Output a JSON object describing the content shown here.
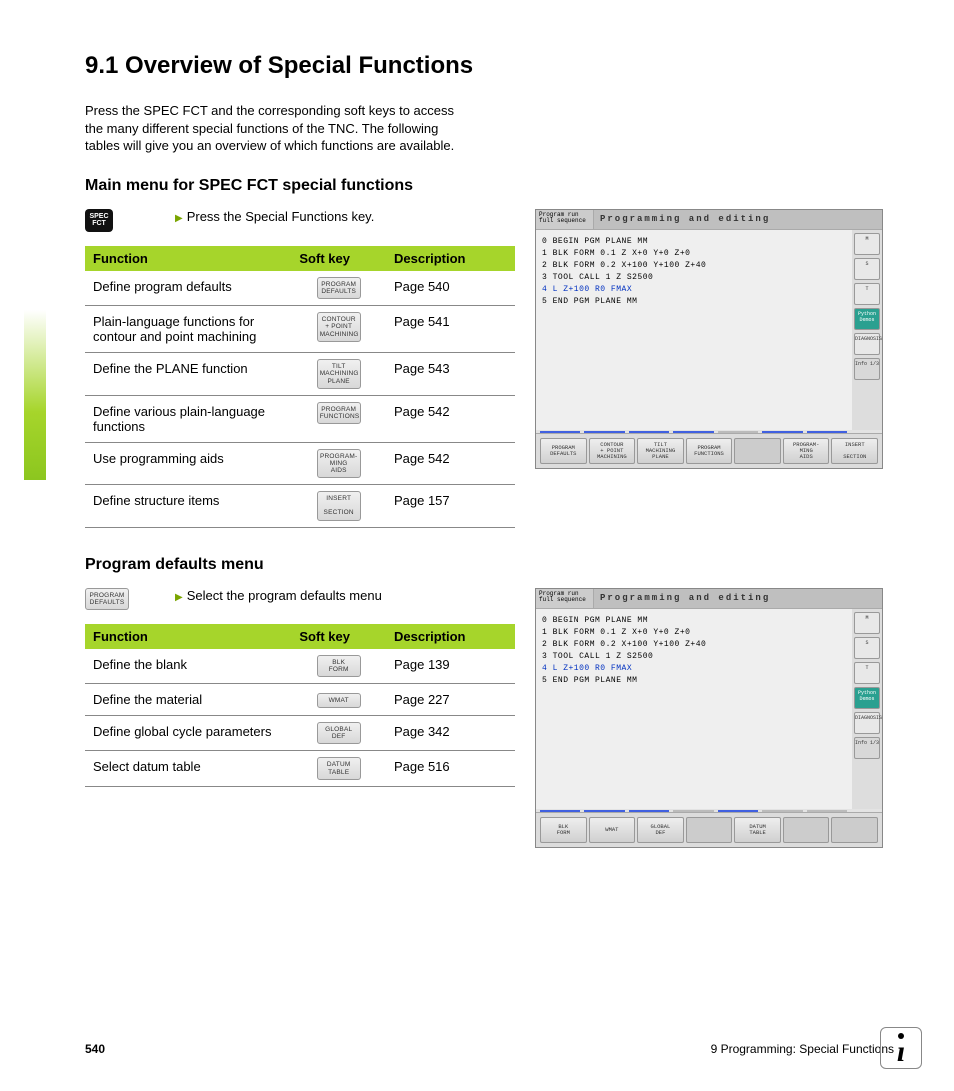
{
  "side_title": "9.1 Overview of Special Functions",
  "heading": "9.1   Overview of Special Functions",
  "intro": "Press the SPEC FCT and the corresponding soft keys to access the many different special functions of the TNC. The following tables will give you an overview of which functions are available.",
  "section1": {
    "title": "Main menu for SPEC FCT special functions",
    "key_label": "SPEC\nFCT",
    "instruction": "Press the Special Functions key.",
    "headers": {
      "c1": "Function",
      "c2": "Soft key",
      "c3": "Description"
    },
    "rows": [
      {
        "func": "Define program defaults",
        "soft": "PROGRAM\nDEFAULTS",
        "desc": "Page 540"
      },
      {
        "func": "Plain-language functions for contour and point machining",
        "soft": "CONTOUR\n+ POINT\nMACHINING",
        "desc": "Page 541"
      },
      {
        "func": "Define the PLANE function",
        "soft": "TILT\nMACHINING\nPLANE",
        "desc": "Page 543"
      },
      {
        "func": "Define various plain-language functions",
        "soft": "PROGRAM\nFUNCTIONS",
        "desc": "Page 542"
      },
      {
        "func": "Use programming aids",
        "soft": "PROGRAM-\nMING\nAIDS",
        "desc": "Page 542"
      },
      {
        "func": "Define structure items",
        "soft": "INSERT\n\nSECTION",
        "desc": "Page 157"
      }
    ]
  },
  "section2": {
    "title": "Program defaults menu",
    "key_label": "PROGRAM\nDEFAULTS",
    "instruction": "Select the program defaults menu",
    "headers": {
      "c1": "Function",
      "c2": "Soft key",
      "c3": "Description"
    },
    "rows": [
      {
        "func": "Define the blank",
        "soft": "BLK\nFORM",
        "desc": "Page 139"
      },
      {
        "func": "Define the material",
        "soft": "WMAT",
        "desc": "Page 227"
      },
      {
        "func": "Define global cycle parameters",
        "soft": "GLOBAL\nDEF",
        "desc": "Page 342"
      },
      {
        "func": "Select datum table",
        "soft": "DATUM\nTABLE",
        "desc": "Page 516"
      }
    ]
  },
  "screen": {
    "mode": "Program run\nfull sequence",
    "title": "Programming and editing",
    "code": {
      "l0": "0   BEGIN PGM PLANE MM",
      "l1": "1   BLK FORM 0.1 Z  X+0    Y+0   Z+0",
      "l2": "2   BLK FORM 0.2  X+100   Y+100  Z+40",
      "l3": "3   TOOL CALL 1 Z S2500",
      "l4": "4   L  Z+100 R0 FMAX",
      "l5": "5   END PGM PLANE MM"
    },
    "side": {
      "b1": "M",
      "b2": "S",
      "b3": "T",
      "b4": "Python\nDemos",
      "b5": "DIAGNOSIS",
      "b6": "Info 1/3"
    },
    "soft1": [
      "PROGRAM\nDEFAULTS",
      "CONTOUR\n+ POINT\nMACHINING",
      "TILT\nMACHINING\nPLANE",
      "PROGRAM\nFUNCTIONS",
      "",
      "PROGRAM-\nMING\nAIDS",
      "INSERT\n\nSECTION"
    ],
    "soft2": [
      "BLK\nFORM",
      "WMAT",
      "GLOBAL\nDEF",
      "",
      "DATUM\nTABLE",
      "",
      ""
    ]
  },
  "footer": {
    "page": "540",
    "chapter": "9 Programming: Special Functions"
  }
}
